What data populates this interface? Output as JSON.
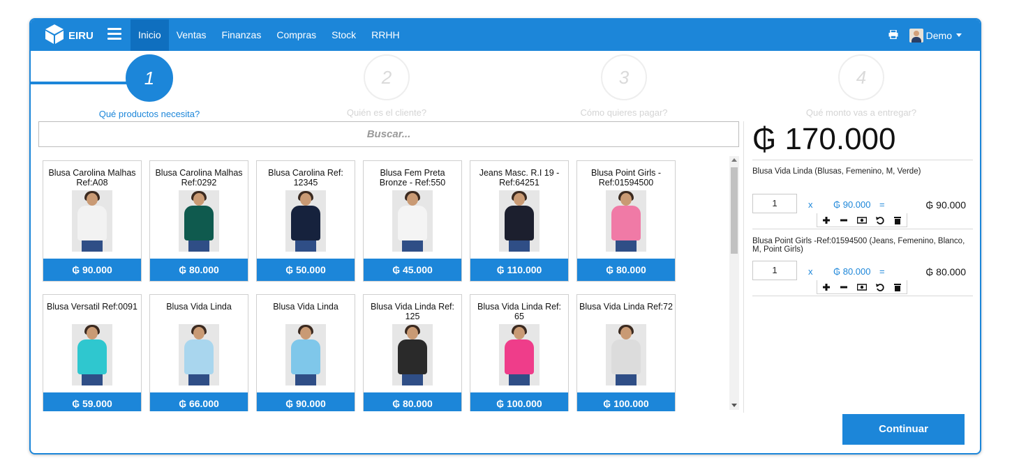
{
  "navbar": {
    "brand": "EIRU",
    "menu": [
      {
        "label": "Inicio",
        "active": true
      },
      {
        "label": "Ventas",
        "active": false
      },
      {
        "label": "Finanzas",
        "active": false
      },
      {
        "label": "Compras",
        "active": false
      },
      {
        "label": "Stock",
        "active": false
      },
      {
        "label": "RRHH",
        "active": false
      }
    ],
    "user": "Demo"
  },
  "steps": [
    {
      "number": "1",
      "label": "Qué productos necesita?",
      "active": true
    },
    {
      "number": "2",
      "label": "Quién es el cliente?",
      "active": false
    },
    {
      "number": "3",
      "label": "Cómo quieres pagar?",
      "active": false
    },
    {
      "number": "4",
      "label": "Qué monto vas a entregar?",
      "active": false
    }
  ],
  "search": {
    "placeholder": "Buscar..."
  },
  "products": [
    {
      "name": "Blusa Carolina Malhas Ref:A08",
      "price": "₲ 90.000",
      "shirt": "#f2f2f2"
    },
    {
      "name": "Blusa Carolina Malhas Ref:0292",
      "price": "₲ 80.000",
      "shirt": "#0f5a4e"
    },
    {
      "name": "Blusa Carolina Ref: 12345",
      "price": "₲ 50.000",
      "shirt": "#16223d"
    },
    {
      "name": "Blusa Fem Preta Bronze - Ref:550",
      "price": "₲ 45.000",
      "shirt": "#f4f4f4"
    },
    {
      "name": "Jeans Masc. R.I 19 - Ref:64251",
      "price": "₲ 110.000",
      "shirt": "#1c1f2e"
    },
    {
      "name": "Blusa Point Girls - Ref:01594500",
      "price": "₲ 80.000",
      "shirt": "#f07aa6"
    },
    {
      "name": "Blusa Versatil Ref:0091",
      "price": "₲ 59.000",
      "shirt": "#2fc7cf"
    },
    {
      "name": "Blusa Vida Linda",
      "price": "₲ 66.000",
      "shirt": "#a9d6ee"
    },
    {
      "name": "Blusa Vida Linda",
      "price": "₲ 90.000",
      "shirt": "#7fc7ea"
    },
    {
      "name": "Blusa Vida Linda Ref: 125",
      "price": "₲ 80.000",
      "shirt": "#2a2a2a"
    },
    {
      "name": "Blusa Vida Linda Ref: 65",
      "price": "₲ 100.000",
      "shirt": "#ef3d8a"
    },
    {
      "name": "Blusa Vida Linda Ref:72",
      "price": "₲ 100.000",
      "shirt": "#dcdcdc"
    }
  ],
  "cart": {
    "total": "₲ 170.000",
    "items": [
      {
        "title": "Blusa Vida Linda (Blusas, Femenino, M, Verde)",
        "qty": "1",
        "x": "x",
        "unit": "₲ 90.000",
        "eq": "=",
        "line_total": "₲ 90.000"
      },
      {
        "title": "Blusa Point Girls -Ref:01594500 (Jeans, Femenino, Blanco, M, Point Girls)",
        "qty": "1",
        "x": "x",
        "unit": "₲ 80.000",
        "eq": "=",
        "line_total": "₲ 80.000"
      }
    ]
  },
  "continue_label": "Continuar",
  "colors": {
    "accent": "#1c86d9"
  }
}
